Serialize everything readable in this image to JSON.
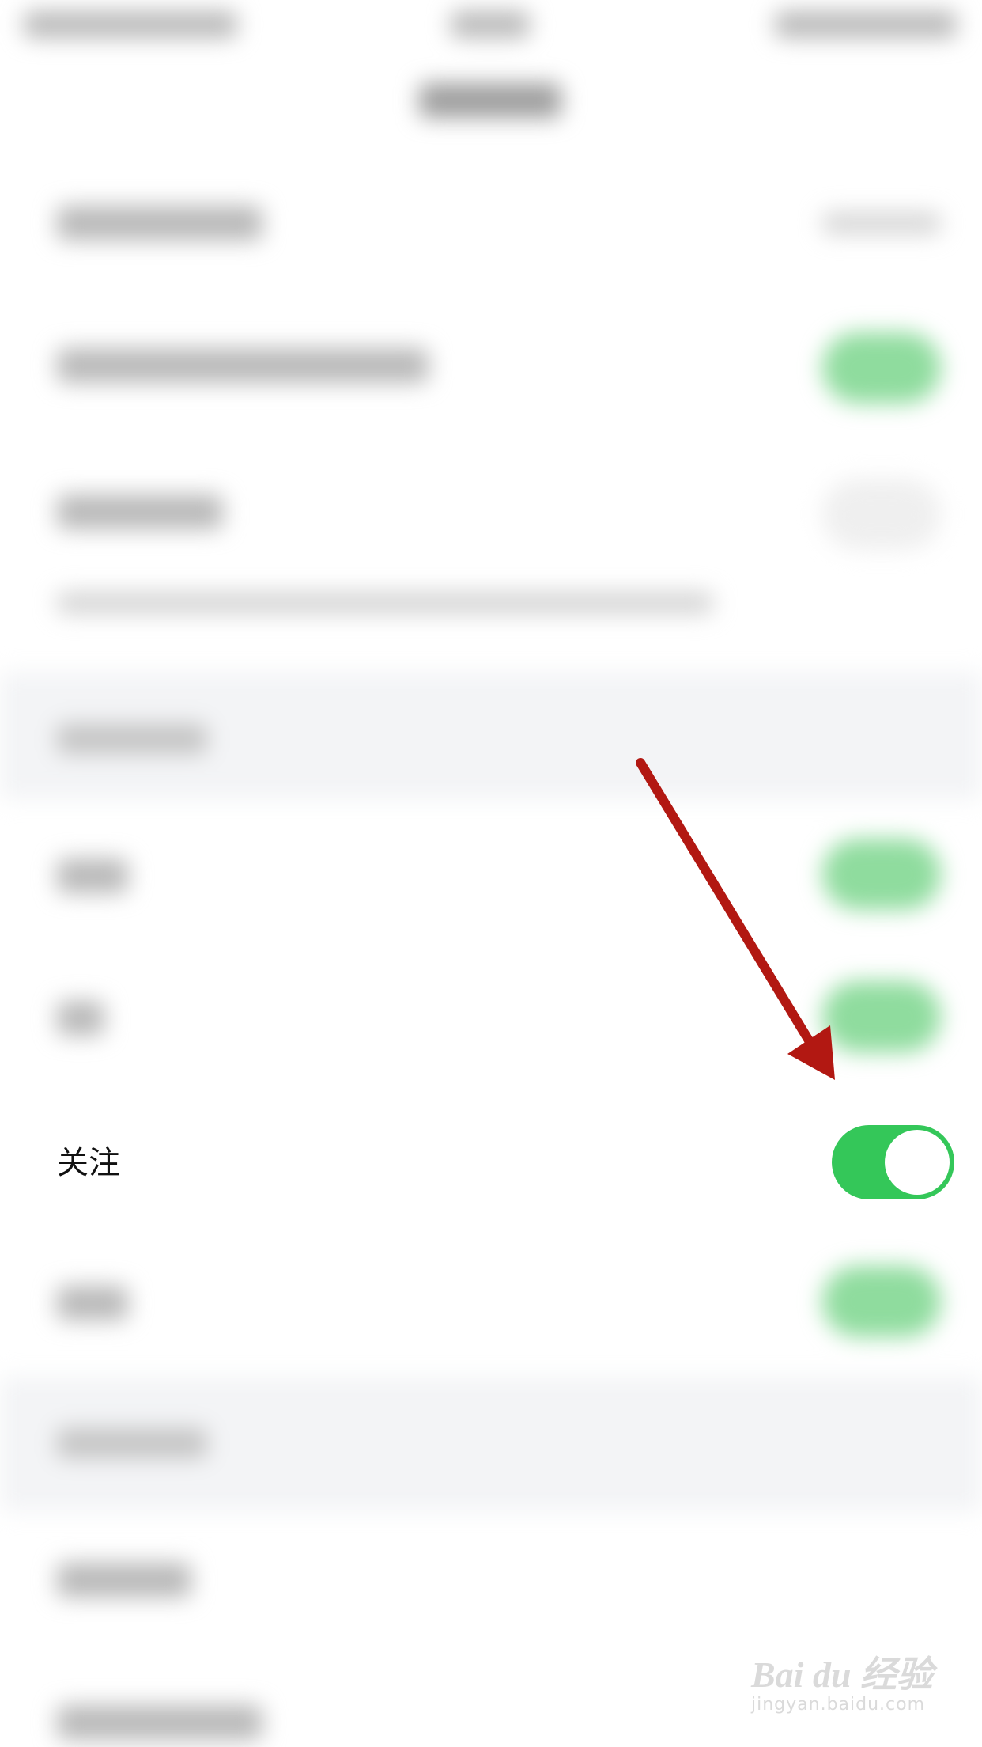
{
  "focus_row": {
    "label": "关注",
    "toggle_on": true
  },
  "colors": {
    "toggle_on": "#34c759",
    "arrow": "#b21812"
  },
  "watermark": {
    "logo": "Bai du 经验",
    "url": "jingyan.baidu.com"
  }
}
